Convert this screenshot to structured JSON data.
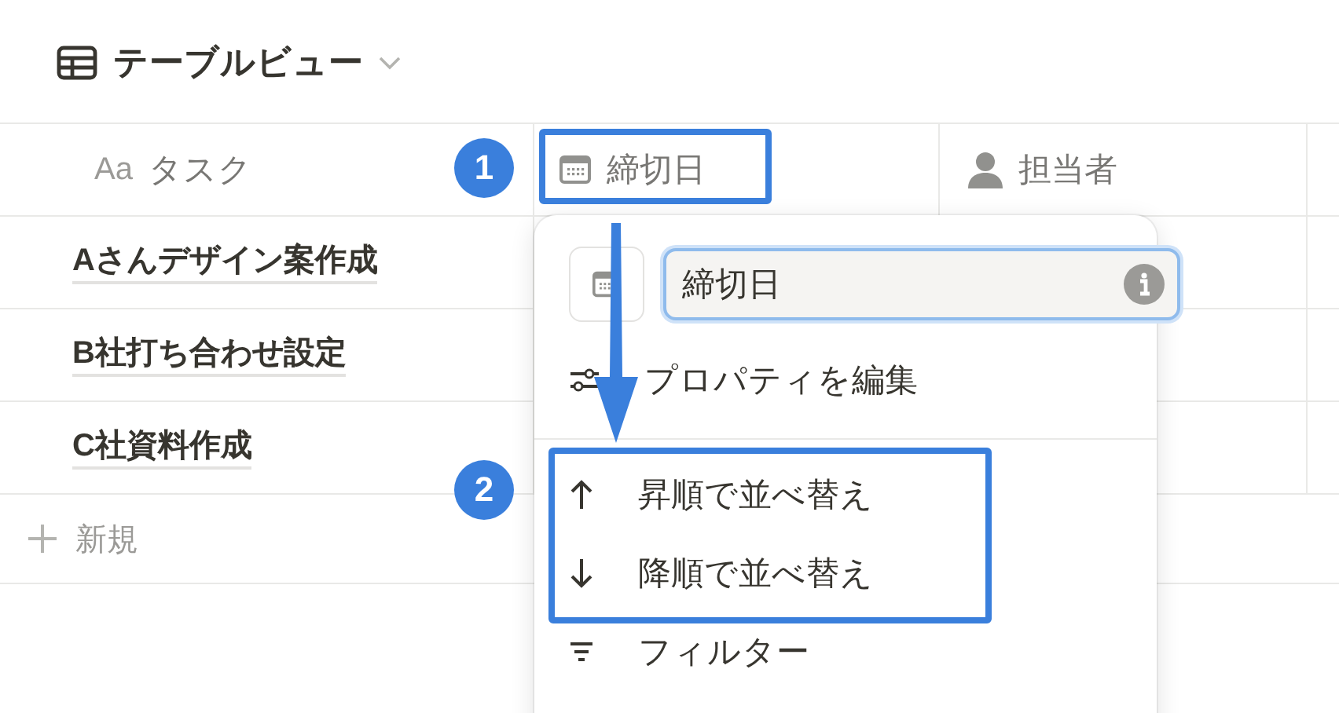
{
  "view": {
    "title": "テーブルビュー"
  },
  "table": {
    "columns": [
      {
        "kind": "title",
        "icon_text": "Aa",
        "label": "タスク"
      },
      {
        "kind": "date",
        "label": "締切日"
      },
      {
        "kind": "person",
        "label": "担当者"
      }
    ],
    "rows": [
      {
        "task": "Aさんデザイン案作成"
      },
      {
        "task": "B社打ち合わせ設定"
      },
      {
        "task": "C社資料作成"
      }
    ],
    "new_row": "新規"
  },
  "menu": {
    "property_name": "締切日",
    "items": [
      {
        "kind": "edit",
        "label": "プロパティを編集"
      },
      {
        "kind": "sort_asc",
        "label": "昇順で並べ替え"
      },
      {
        "kind": "sort_desc",
        "label": "降順で並べ替え"
      },
      {
        "kind": "filter",
        "label": "フィルター"
      }
    ]
  },
  "annotations": [
    {
      "label": "1"
    },
    {
      "label": "2"
    }
  ]
}
